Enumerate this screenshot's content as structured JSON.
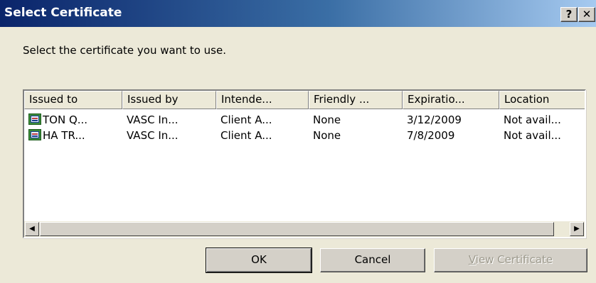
{
  "window": {
    "title": "Select Certificate",
    "help_glyph": "?",
    "close_glyph": "✕"
  },
  "prompt": "Select the certificate you want to use.",
  "list": {
    "columns": [
      "Issued to",
      "Issued by",
      "Intende...",
      "Friendly ...",
      "Expiratio...",
      "Location"
    ],
    "rows": [
      {
        "icon": "certificate-icon",
        "issued_to": "TON Q...",
        "issued_by": "VASC In...",
        "intended": "Client A...",
        "friendly": "None",
        "expiration": "3/12/2009",
        "location": "Not avail..."
      },
      {
        "icon": "certificate-icon",
        "issued_to": "HA TR...",
        "issued_by": "VASC In...",
        "intended": "Client A...",
        "friendly": "None",
        "expiration": "7/8/2009",
        "location": "Not avail..."
      }
    ]
  },
  "buttons": {
    "ok": "OK",
    "cancel": "Cancel",
    "view_accel": "V",
    "view_rest": "iew Certificate"
  },
  "colors": {
    "title_gradient_start": "#0a246a",
    "face": "#ece9d8",
    "disabled_text": "#9d9a8d"
  }
}
